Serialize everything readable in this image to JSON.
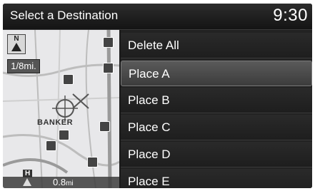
{
  "header": {
    "title": "Select a Destination",
    "clock": "9:30"
  },
  "map": {
    "compass_label": "N",
    "scale_label": "1/8mi.",
    "place_label": "BANKER",
    "highway_label": "H",
    "distance_value": "0.8",
    "distance_unit": "mi"
  },
  "list": {
    "items": [
      {
        "label": "Delete All"
      },
      {
        "label": "Place A"
      },
      {
        "label": "Place B"
      },
      {
        "label": "Place C"
      },
      {
        "label": "Place D"
      },
      {
        "label": "Place E"
      }
    ],
    "selected_index": 1
  },
  "colors": {
    "background": "#1a1a1a",
    "selected": "#4a4a4a",
    "text": "#ffffff",
    "map": "#e8e8ea"
  }
}
